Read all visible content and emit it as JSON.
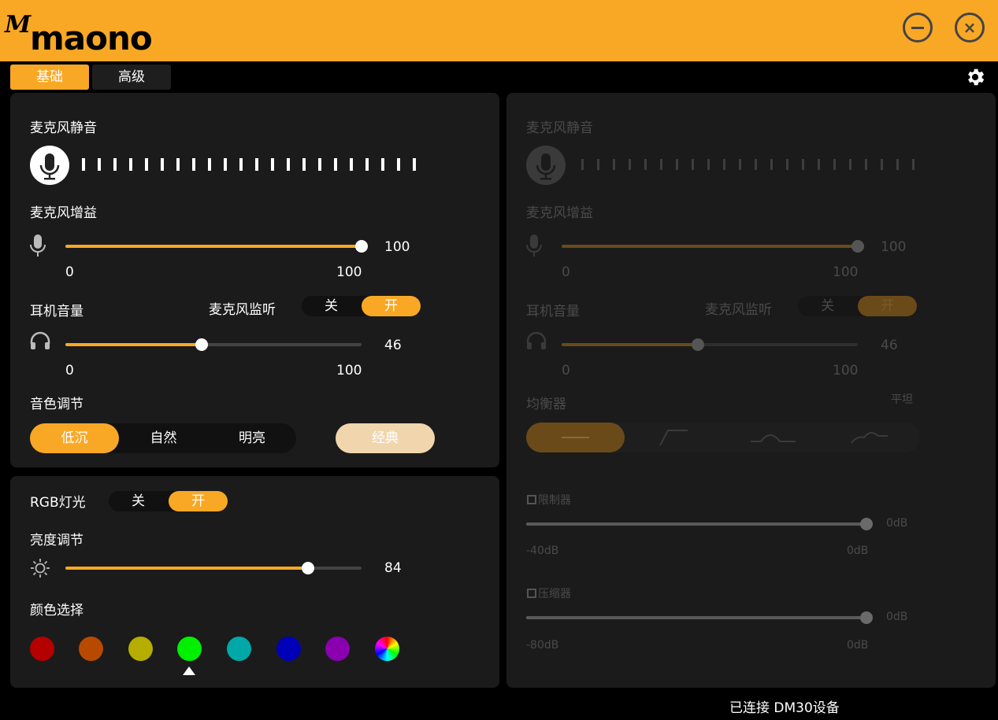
{
  "app": {
    "logo_text": "maono",
    "logo_mark": "M"
  },
  "window_controls": {
    "minimize_icon": "minimize-circle-icon",
    "close_symbol": "×"
  },
  "tabs": [
    {
      "label": "基础",
      "active": true
    },
    {
      "label": "高级",
      "active": false
    }
  ],
  "settings_icon": "gear-icon",
  "basic": {
    "mic_mute_label": "麦克风静音",
    "mic_gain": {
      "label": "麦克风增益",
      "value": "100",
      "min": "0",
      "max": "100"
    },
    "headphone_volume": {
      "label": "耳机音量",
      "value": "46",
      "min": "0",
      "max": "100"
    },
    "mic_monitor": {
      "label": "麦克风监听",
      "off": "关",
      "on": "开",
      "state": "on"
    },
    "tone": {
      "label": "音色调节",
      "options": [
        "低沉",
        "自然",
        "明亮"
      ],
      "selected": "低沉",
      "classic": "经典"
    },
    "rgb": {
      "label": "RGB灯光",
      "off": "关",
      "on": "开",
      "state": "on"
    },
    "brightness": {
      "label": "亮度调节",
      "value": "84"
    },
    "color_select": {
      "label": "颜色选择",
      "colors": [
        "#b50000",
        "#b84a00",
        "#b5ad00",
        "#00f000",
        "#00a8a8",
        "#0000b8",
        "#8a00b0",
        "rainbow"
      ],
      "selected_index": 3
    }
  },
  "advanced": {
    "mic_mute_label": "麦克风静音",
    "mic_gain": {
      "label": "麦克风增益",
      "value": "100",
      "min": "0",
      "max": "100"
    },
    "headphone_volume": {
      "label": "耳机音量",
      "value": "46",
      "min": "0",
      "max": "100"
    },
    "mic_monitor": {
      "label": "麦克风监听",
      "off": "关",
      "on": "开"
    },
    "equalizer": {
      "label": "均衡器",
      "preset": "平坦"
    },
    "limiter": {
      "label": "限制器",
      "value": "0dB",
      "min": "-40dB",
      "max": "0dB"
    },
    "compressor": {
      "label": "压缩器",
      "value": "0dB",
      "min": "-80dB",
      "max": "0dB"
    }
  },
  "status_text": "已连接 DM30设备"
}
